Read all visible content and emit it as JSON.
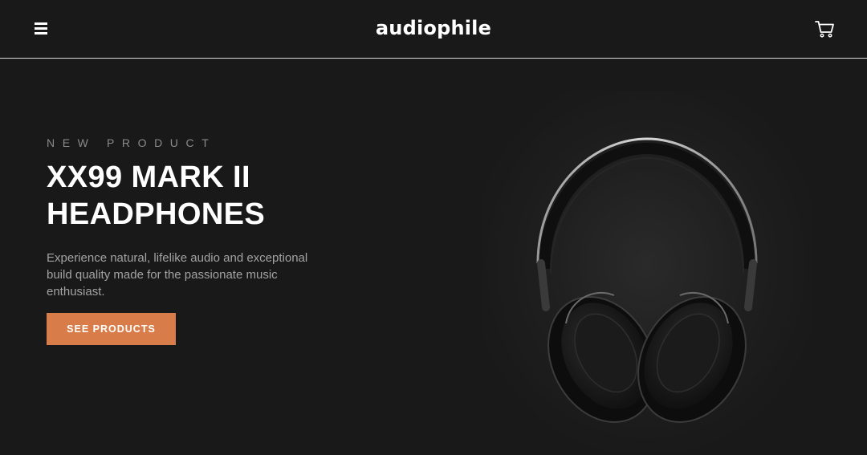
{
  "header": {
    "menu_icon": "hamburger-menu-icon",
    "logo": "audiophile",
    "cart_icon": "shopping-cart-icon"
  },
  "hero": {
    "overline": "New Product",
    "title_line1": "XX99 Mark II",
    "title_line2": "Headphones",
    "description": "Experience natural, lifelike audio and exceptional build quality made for the passionate music enthusiast.",
    "cta_label": "See Products",
    "image": "over-ear headphones photo"
  },
  "colors": {
    "background": "#191919",
    "accent": "#d87d4a",
    "text_primary": "#ffffff",
    "text_muted": "#a3a3a3"
  }
}
